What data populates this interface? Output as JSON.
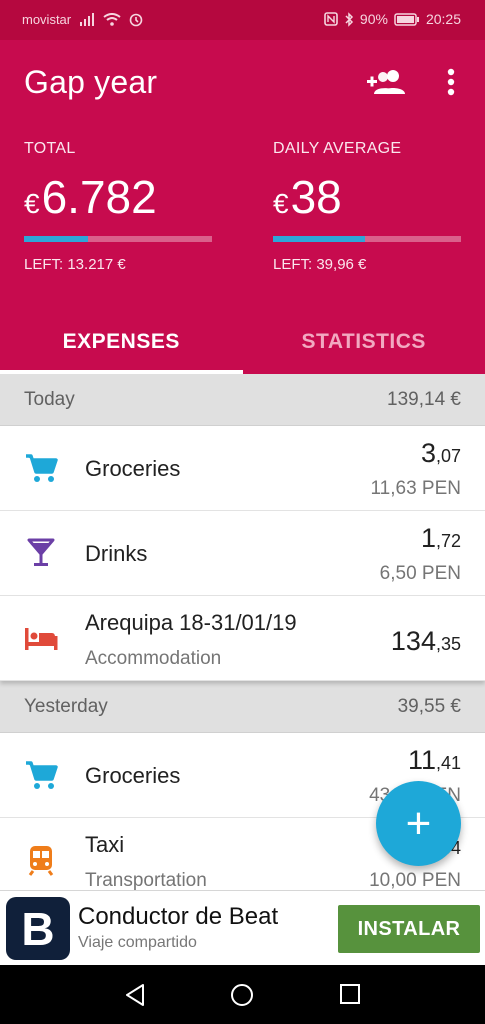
{
  "status_bar": {
    "carrier": "movistar",
    "battery": "90%",
    "time": "20:25"
  },
  "header": {
    "title": "Gap year",
    "total": {
      "label": "TOTAL",
      "currency": "€",
      "value": "6.782",
      "progress": 0.34,
      "left": "LEFT: 13.217 €"
    },
    "daily": {
      "label": "DAILY AVERAGE",
      "currency": "€",
      "value": "38",
      "progress": 0.49,
      "left": "LEFT: 39,96 €"
    },
    "tabs": [
      {
        "label": "EXPENSES",
        "active": true
      },
      {
        "label": "STATISTICS",
        "active": false
      }
    ]
  },
  "days": [
    {
      "label": "Today",
      "total": "139,14 €",
      "items": [
        {
          "name": "Groceries",
          "category": "",
          "amount_int": "3",
          "amount_dec": ",07",
          "original": "11,63 PEN",
          "icon": "cart-icon"
        },
        {
          "name": "Drinks",
          "category": "",
          "amount_int": "1",
          "amount_dec": ",72",
          "original": "6,50 PEN",
          "icon": "cocktail-icon"
        },
        {
          "name": "Arequipa 18-31/01/19",
          "category": "Accommodation",
          "amount_int": "134",
          "amount_dec": ",35",
          "original": "",
          "icon": "bed-icon"
        }
      ]
    },
    {
      "label": "Yesterday",
      "total": "39,55 €",
      "items": [
        {
          "name": "Groceries",
          "category": "",
          "amount_int": "11",
          "amount_dec": ",41",
          "original": "43,00 PEN",
          "icon": "cart-icon"
        },
        {
          "name": "Taxi",
          "category": "Transportation",
          "amount_int": "2",
          "amount_dec": ",64",
          "original": "10,00 PEN",
          "icon": "train-icon"
        }
      ]
    }
  ],
  "fab": {
    "label": "+"
  },
  "ad": {
    "logo": "B",
    "headline": "Conductor de Beat",
    "subtitle": "Viaje compartido",
    "button": "INSTALAR"
  },
  "colors": {
    "primary": "#c70b4e",
    "status_bar": "#b5083f",
    "accent": "#1ea8d8",
    "install_green": "#57923d"
  }
}
